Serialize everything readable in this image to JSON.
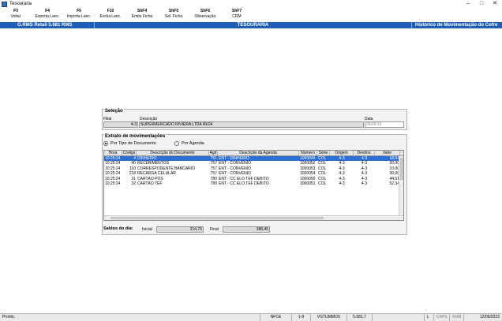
{
  "window": {
    "title": "Tesouraria",
    "controls": [
      "–",
      "□",
      "✕"
    ]
  },
  "toolbar": [
    {
      "key": "F3",
      "label": "Voltar"
    },
    {
      "key": "F4",
      "label": "Exporta Lanc."
    },
    {
      "key": "F5",
      "label": "Importa Lanc."
    },
    {
      "key": "F10",
      "label": "Exclui Lanc."
    },
    {
      "key": "ShF4",
      "label": "Emite Ficha"
    },
    {
      "key": "ShF5",
      "label": "Sel. Ficha"
    },
    {
      "key": "ShF6",
      "label": "Observação"
    },
    {
      "key": "ShF7",
      "label": "CRM"
    }
  ],
  "header": {
    "left": "G.RMS Retail 5.681 RMS",
    "center": "TESOURARIA",
    "right": "Histórico de Movimentação do Cofre"
  },
  "selecao": {
    "title": "Seleção",
    "filial_label": "Filial",
    "filial_value": "4-3",
    "descricao_label": "Descrição",
    "descricao_value": "SUPERMERCADO RIVIERA LTDA RK04",
    "data_label": "Data",
    "data_value": "05/05/15"
  },
  "extrato": {
    "title": "Extrato de movimentações",
    "radio_tipo": "Por Tipo de Documento",
    "radio_agenda": "Por Agenda",
    "selected_radio": "tipo"
  },
  "grid": {
    "headers": [
      "Hora",
      "Código",
      "Descrição do Documento",
      "Agd",
      "Descrição da Agenda",
      "Número",
      "Série",
      "Origem",
      "Destino",
      "Valor"
    ],
    "rows": [
      [
        "10:25:24",
        "4",
        "DINHEIRO",
        "751",
        "ENT - DINHEIRO",
        "1000049",
        "COL",
        "4-3",
        "4-3",
        "18,64"
      ],
      [
        "10:25:24",
        "40",
        "RECEBIMENTOS",
        "757",
        "ENT - CONVENIO",
        "1000052",
        "COL",
        "4-3",
        "4-3",
        "20,00"
      ],
      [
        "10:25:24",
        "110",
        "CORRESPODENTE BANCARIO",
        "757",
        "ENT - CONVENIO",
        "1000053",
        "COL",
        "4-3",
        "4-3",
        "10,00"
      ],
      [
        "10:25:24",
        "218",
        "RECARGA CELULAR",
        "757",
        "ENT - CONVENIO",
        "1000054",
        "COL",
        "4-3",
        "4-3",
        "30,00"
      ],
      [
        "10:25:24",
        "31",
        "CARTÃO POS",
        "780",
        "ENT - CC ELO TEF DEBITO",
        "1000050",
        "COL",
        "4-3",
        "4-3",
        "44,51"
      ],
      [
        "10:25:24",
        "32",
        "CARTÃO TEF",
        "780",
        "ENT - CC ELO TEF DEBITO",
        "1000051",
        "COL",
        "4-3",
        "4-3",
        "52,34"
      ]
    ]
  },
  "saldos": {
    "label": "Saldos do dia:",
    "inicial_label": "Inicial",
    "inicial_value": "214,76",
    "final_label": "Final",
    "final_value": "388,45"
  },
  "status": {
    "text": "Pronto.",
    "mode": "NFCE",
    "page": "1-9",
    "user": "VGTUMMOV",
    "version": "5.681.7",
    "flags": [
      "L",
      "CAPS",
      "NUM"
    ],
    "date": "12/06/2015"
  }
}
